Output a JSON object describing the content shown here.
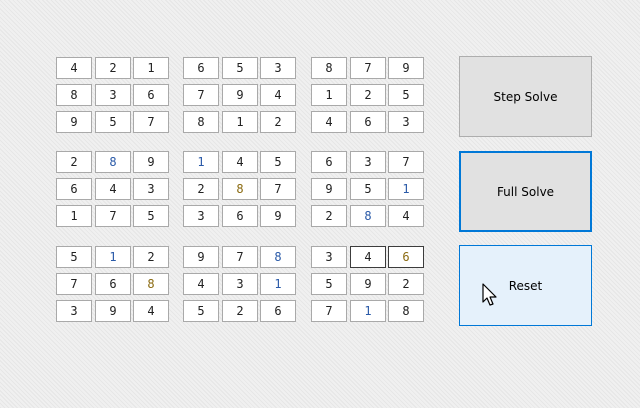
{
  "grid": [
    [
      "4",
      "2",
      "1",
      "6",
      "5",
      "3",
      "8",
      "7",
      "9"
    ],
    [
      "8",
      "3",
      "6",
      "7",
      "9",
      "4",
      "1",
      "2",
      "5"
    ],
    [
      "9",
      "5",
      "7",
      "8",
      "1",
      "2",
      "4",
      "6",
      "3"
    ],
    [
      "2",
      "8",
      "9",
      "1",
      "4",
      "5",
      "6",
      "3",
      "7"
    ],
    [
      "6",
      "4",
      "3",
      "2",
      "8",
      "7",
      "9",
      "5",
      "1"
    ],
    [
      "1",
      "7",
      "5",
      "3",
      "6",
      "9",
      "2",
      "8",
      "4"
    ],
    [
      "5",
      "1",
      "2",
      "9",
      "7",
      "8",
      "3",
      "4",
      "6"
    ],
    [
      "7",
      "6",
      "8",
      "4",
      "3",
      "1",
      "5",
      "9",
      "2"
    ],
    [
      "3",
      "9",
      "4",
      "5",
      "2",
      "6",
      "7",
      "1",
      "8"
    ]
  ],
  "highlight_colors": {
    "blue": "#2a5aa8",
    "gold": "#8a6a10"
  },
  "blue_cells": [
    [
      3,
      1
    ],
    [
      3,
      3
    ],
    [
      4,
      8
    ],
    [
      5,
      7
    ],
    [
      6,
      1
    ],
    [
      6,
      5
    ],
    [
      7,
      5
    ],
    [
      8,
      7
    ]
  ],
  "gold_cells": [
    [
      4,
      4
    ],
    [
      6,
      8
    ],
    [
      7,
      2
    ]
  ],
  "outlined_cells": [
    [
      6,
      7
    ],
    [
      6,
      8
    ]
  ],
  "buttons": {
    "step_solve": "Step Solve",
    "full_solve": "Full Solve",
    "reset": "Reset"
  },
  "cursor": "arrow-pointer-icon"
}
